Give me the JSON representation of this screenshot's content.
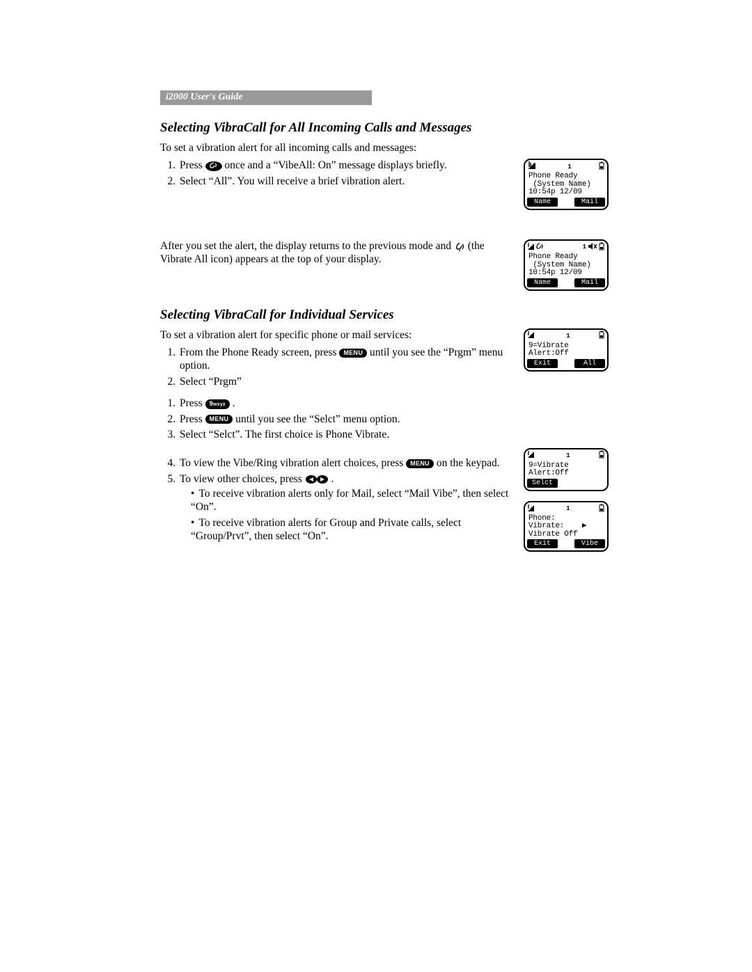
{
  "header": {
    "title": "i2000 User's Guide"
  },
  "section1": {
    "title": "Selecting VibraCall for All Incoming Calls and Messages",
    "intro": "To set a vibration alert for all incoming calls and messages:",
    "steps": [
      {
        "pre": "Press ",
        "key": "vibe",
        "post": " once and a “VibeAll: On” message displays briefly."
      },
      {
        "pre": "Select “All”. You will receive a brief vibration alert.",
        "key": null,
        "post": ""
      }
    ],
    "after_pre": "After you set the alert, the display returns to the previous mode and ",
    "after_mid": " (the Vibrate All icon) appears at the top of your display."
  },
  "section2": {
    "title": "Selecting VibraCall for Individual Services",
    "intro": "To set a vibration alert for specific phone or mail services:",
    "stepsA": [
      {
        "pre": "From the Phone Ready screen, press ",
        "key": "MENU",
        "post": " until you see the “Prgm” menu option."
      },
      {
        "pre": "Select “Prgm”",
        "key": null,
        "post": ""
      }
    ],
    "stepsB": [
      {
        "pre": "Press ",
        "key": "9wxyz",
        "post": "."
      },
      {
        "pre": "Press ",
        "key": "MENU",
        "post": " until you see the “Selct” menu option."
      },
      {
        "pre": "Select “Selct”. The first choice is Phone Vibrate.",
        "key": null,
        "post": ""
      },
      {
        "pre": "To view the Vibe/Ring vibration alert choices, press ",
        "key": "MENU",
        "post": " on the keypad."
      },
      {
        "pre": "To view other choices, press ",
        "key": "arrows",
        "post": "."
      }
    ],
    "bullets": [
      "To receive vibration alerts only for Mail, select “Mail Vibe”, then select “On”.",
      "To receive vibration alerts for Group and Private calls, select “Group/Prvt”, then select “On”."
    ]
  },
  "screens": {
    "s1": {
      "digit": "1",
      "lines": [
        "Phone Ready",
        " (System Name)",
        "10:54p 12/09"
      ],
      "sk_left": "Name",
      "sk_right": "Mail",
      "icons": {
        "signal": true,
        "battery": true,
        "vibe": false,
        "mute": false
      }
    },
    "s2": {
      "digit": "1",
      "lines": [
        "Phone Ready",
        " (System Name)",
        "10:54p 12/09"
      ],
      "sk_left": "Name",
      "sk_right": "Mail",
      "icons": {
        "signal": true,
        "battery": true,
        "vibe": true,
        "mute": true
      }
    },
    "s3": {
      "digit": "1",
      "lines": [
        "9=Vibrate",
        "Alert:Off",
        ""
      ],
      "sk_left": "Exit",
      "sk_right": "All",
      "icons": {
        "signal": true,
        "battery": true,
        "vibe": false,
        "mute": false
      }
    },
    "s4": {
      "digit": "1",
      "lines": [
        "9=Vibrate",
        "Alert:Off",
        ""
      ],
      "sk_left": "Selct",
      "sk_right": "",
      "icons": {
        "signal": true,
        "battery": true,
        "vibe": false,
        "mute": false
      }
    },
    "s5": {
      "digit": "1",
      "lines": [
        "Phone:",
        "Vibrate:    ▶",
        "Vibrate Off"
      ],
      "sk_left": "Exit",
      "sk_right": "Vibe",
      "icons": {
        "signal": true,
        "battery": true,
        "vibe": false,
        "mute": false
      }
    }
  }
}
